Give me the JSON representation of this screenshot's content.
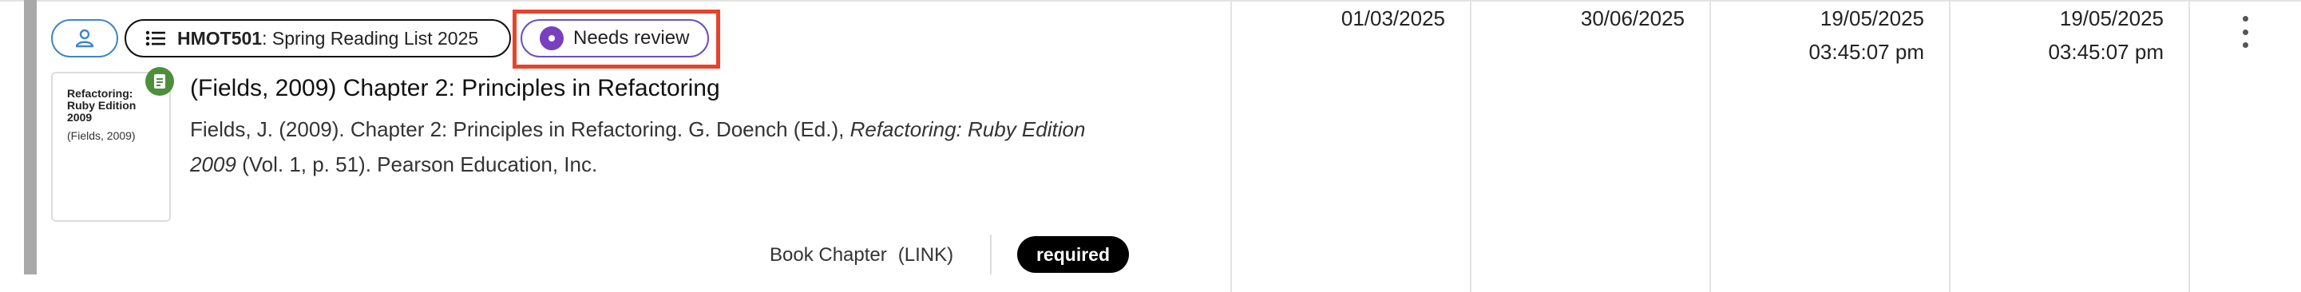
{
  "list_chip": {
    "code": "HMOT501",
    "name": ": Spring Reading List 2025"
  },
  "status_chip": {
    "label": "Needs review",
    "color": "#7a3fc0"
  },
  "thumbnail": {
    "title": "Refactoring: Ruby Edition 2009",
    "citation": "(Fields, 2009)",
    "badge_icon": "document-icon",
    "badge_color": "#4d8f3c"
  },
  "item": {
    "title": "(Fields, 2009) Chapter 2: Principles in Refactoring",
    "citation_before": "Fields, J. (2009). Chapter 2: Principles in Refactoring. G. Doench (Ed.), ",
    "citation_italic": "Refactoring: Ruby Edition 2009",
    "citation_after": " (Vol. 1, p. 51). Pearson Education, Inc.",
    "type": "Book Chapter",
    "link_label": "(LINK)",
    "importance": "required"
  },
  "dates": {
    "col1": "01/03/2025",
    "col2": "30/06/2025",
    "col3_date": "19/05/2025",
    "col3_time": "03:45:07 pm",
    "col4_date": "19/05/2025",
    "col4_time": "03:45:07 pm"
  },
  "colors": {
    "accent_blue": "#3f86c8",
    "highlight_red": "#e8432a",
    "left_bar": "#a9a9a9"
  }
}
